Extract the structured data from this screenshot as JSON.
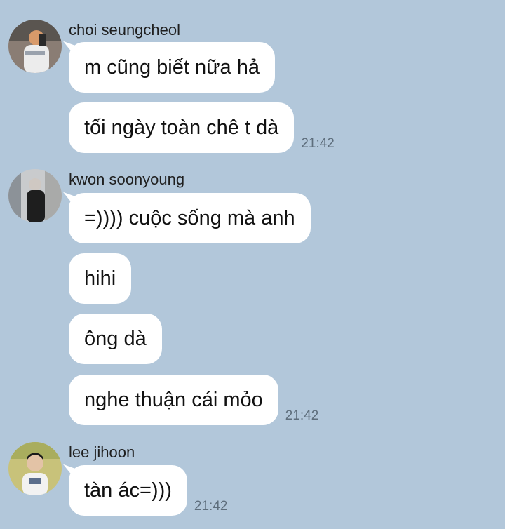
{
  "chat": {
    "groups": [
      {
        "sender": "choi seungcheol",
        "avatar_icon": "user-avatar-photo",
        "messages": [
          {
            "text": "m cũng biết nữa hả"
          },
          {
            "text": "tối ngày toàn chê t dà",
            "time": "21:42"
          }
        ]
      },
      {
        "sender": "kwon soonyoung",
        "avatar_icon": "user-avatar-photo",
        "messages": [
          {
            "text": "=)))) cuộc sống mà anh"
          },
          {
            "text": "hihi"
          },
          {
            "text": "ông dà"
          },
          {
            "text": "nghe thuận cái mỏo",
            "time": "21:42"
          }
        ]
      },
      {
        "sender": "lee jihoon",
        "avatar_icon": "user-avatar-photo",
        "messages": [
          {
            "text": "tàn ác=)))",
            "time": "21:42"
          }
        ]
      }
    ]
  },
  "colors": {
    "background": "#b2c7da",
    "bubble": "#ffffff",
    "time_text": "#5e6e7c"
  }
}
